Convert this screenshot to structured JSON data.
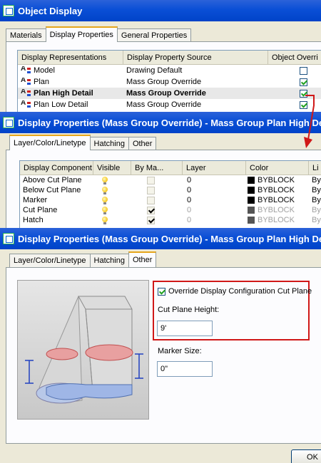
{
  "win1": {
    "title": "Object Display",
    "tabs": [
      "Materials",
      "Display Properties",
      "General Properties"
    ],
    "columns": [
      "Display Representations",
      "Display Property Source",
      "Object Overri"
    ],
    "rows": [
      {
        "name": "Model",
        "source": "Drawing Default",
        "checked": false,
        "bold": false
      },
      {
        "name": "Plan",
        "source": "Mass Group Override",
        "checked": true,
        "bold": false
      },
      {
        "name": "Plan High Detail",
        "source": "Mass Group Override",
        "checked": true,
        "bold": true
      },
      {
        "name": "Plan Low Detail",
        "source": "Mass Group Override",
        "checked": true,
        "bold": false
      }
    ]
  },
  "win2": {
    "title": "Display Properties (Mass Group Override) - Mass Group Plan High Det",
    "tabs": [
      "Layer/Color/Linetype",
      "Hatching",
      "Other"
    ],
    "columns": [
      "Display Component",
      "Visible",
      "By Ma...",
      "Layer",
      "Color",
      "Li"
    ],
    "rows": [
      {
        "component": "Above Cut Plane",
        "bymat": false,
        "layer": "0",
        "color": "BYBLOCK",
        "linetype": "ByB",
        "dim": false
      },
      {
        "component": "Below Cut Plane",
        "bymat": false,
        "layer": "0",
        "color": "BYBLOCK",
        "linetype": "ByB",
        "dim": false
      },
      {
        "component": "Marker",
        "bymat": false,
        "layer": "0",
        "color": "BYBLOCK",
        "linetype": "ByB",
        "dim": false
      },
      {
        "component": "Cut Plane",
        "bymat": true,
        "layer": "0",
        "color": "BYBLOCK",
        "linetype": "ByB",
        "dim": true
      },
      {
        "component": "Hatch",
        "bymat": true,
        "layer": "0",
        "color": "BYBLOCK",
        "linetype": "ByB",
        "dim": true
      }
    ]
  },
  "win3": {
    "title": "Display Properties (Mass Group Override) - Mass Group Plan High Det",
    "tabs": [
      "Layer/Color/Linetype",
      "Hatching",
      "Other"
    ],
    "override_label": "Override Display Configuration Cut Plane",
    "override_checked": true,
    "cut_height_label": "Cut Plane Height:",
    "cut_height_value": "9'",
    "marker_size_label": "Marker Size:",
    "marker_size_value": "0\"",
    "ok_label": "OK"
  },
  "colors": {
    "accent_red": "#d01818",
    "title_blue": "#0a4fd6",
    "tab_orange": "#e6a61c"
  }
}
